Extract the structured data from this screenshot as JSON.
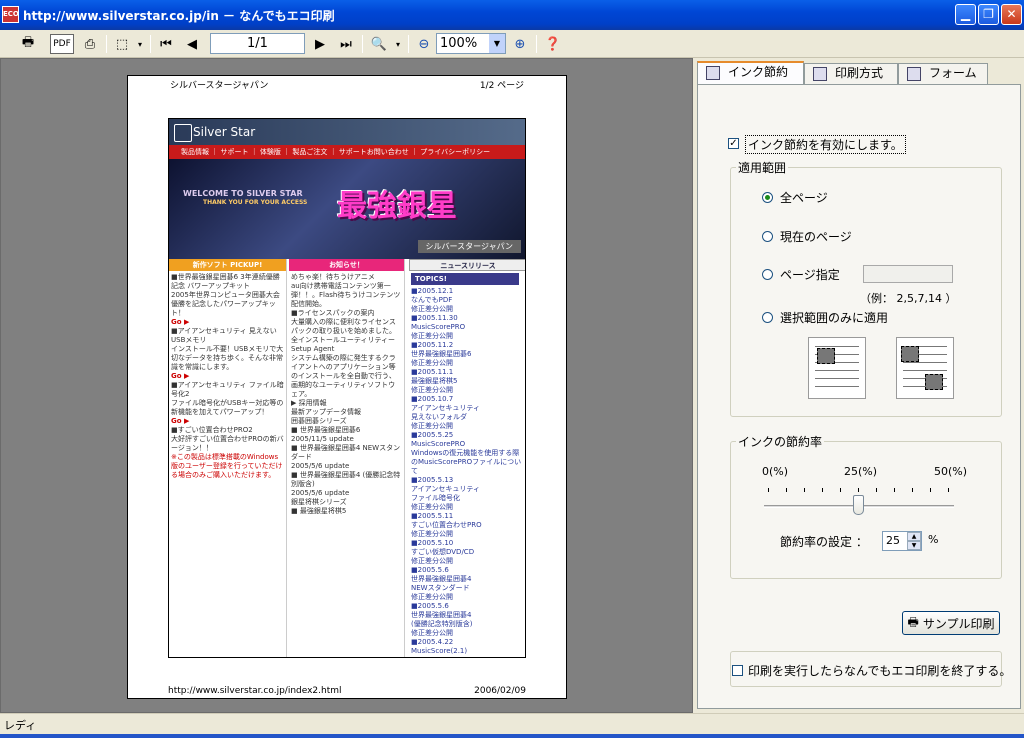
{
  "window": {
    "title": "http://www.silverstar.co.jp/in － なんでもエコ印刷",
    "app_icon": "eco-icon"
  },
  "toolbar": {
    "page_value": "1/1",
    "zoom_value": "100%",
    "buttons": [
      "print-icon",
      "pdf-icon",
      "printer-settings-icon",
      "select-icon",
      "first-page-icon",
      "prev-page-icon",
      "next-page-icon",
      "last-page-icon",
      "zoom-icon",
      "zoom-out-icon",
      "zoom-in-icon",
      "help-icon"
    ]
  },
  "preview": {
    "header_left": "シルバースタージャパン",
    "header_right": "1/2 ページ",
    "footer_left": "http://www.silverstar.co.jp/index2.html",
    "footer_right": "2006/02/09",
    "site": {
      "logo": "Silver Star",
      "nav": "製品情報 ｜ サポート ｜ 体験版 ｜ 製品ご注文 ｜ サポートお問い合わせ ｜ プライバシーポリシー",
      "welcome": "WELCOME TO SILVER STAR",
      "welcome_sub": "THANK YOU FOR YOUR ACCESS",
      "banner_title": "最強銀星",
      "banner_sub": "シルバースタージャパン",
      "col1_head": "新作ソフト PICKUP!",
      "col2_head": "お知らせ！",
      "col3_head": "ニュースリリース",
      "topics": "TOPICS!",
      "col1_items": [
        "■世界最強銀星囲碁6 3年連続優勝記念 バワーアップキット",
        "2005年世界コンピュータ囲碁大会優勝を記念したパワーアップキット！",
        "Go ▶",
        "■アイアンセキュリティ 見えないUSBメモリ",
        "インストール不要！USBメモリで大切なデータを持ち歩く。そんな非常識を常識にします。",
        "Go ▶",
        "■アイアンセキュリティ ファイル暗号化2",
        "ファイル暗号化がUSBキー対応等の新機能を加えてパワーアップ！",
        "Go ▶",
        "■すごい位置合わせPRO2",
        "大好評すごい位置合わせPROの新バージョン！！"
      ],
      "col1_note": "※この製品は標準搭載のWindows版のユーザー登録を行っていただける場合のみご購入いただけます。",
      "col2_items": [
        "めちゃ楽！待ちうけアニメ",
        "au向け携帯電話コンテンツ第一弾！！。Flash待ちうけコンテンツ配信開始。",
        "■ライセンスパックの案内",
        "大量購入の際に便利なライセンスパックの取り扱いを始めました。",
        "全インストールユーティリティー",
        "Setup Agent",
        "システム構築の際に発生するクライアントへのアプリケーション等のインストールを全自動で行う、画期的なユーティリティソフトウェア。",
        "▶ 採用情報",
        "最新アップデータ情報",
        "囲碁囲碁シリーズ",
        "■ 世界最強銀星囲碁6",
        "2005/11/5 update",
        "■ 世界最強銀星囲碁4 NEWスタンダード",
        "2005/5/6 update",
        "■ 世界最強銀星囲碁4 (優勝記念特別版含)",
        "2005/5/6 update",
        "銀星将棋シリーズ",
        "■ 最強銀星将棋5"
      ],
      "col3_items": [
        "■2005.12.1",
        "なんでもPDF",
        "修正差分公開",
        "■2005.11.30",
        "MusicScorePRO",
        "修正差分公開",
        "■2005.11.2",
        "世界最強銀星囲碁6",
        "修正差分公開",
        "■2005.11.1",
        "最強銀星将棋5",
        "修正差分公開",
        "■2005.10.7",
        "アイアンセキュリティ",
        "見えないフォルダ",
        "修正差分公開",
        "■2005.5.25",
        "MusicScorePRO",
        "Windowsの復元機能を使用する際のMusicScorePROファイルについて",
        "■2005.5.13",
        "アイアンセキュリティ",
        "ファイル暗号化",
        "修正差分公開",
        "■2005.5.11",
        "すごい位置合わせPRO",
        "修正差分公開",
        "■2005.5.10",
        "すごい仮想DVD/CD",
        "修正差分公開",
        "■2005.5.6",
        "世界最強銀星囲碁4",
        "NEWスタンダード",
        "修正差分公開",
        "■2005.5.6",
        "世界最強銀星囲碁4",
        "(優勝記念特別版含)",
        "修正差分公開",
        "■2005.4.22",
        "MusicScore(2.1)"
      ]
    }
  },
  "status": {
    "text": "レディ"
  },
  "panel": {
    "tabs": [
      {
        "label": "インク節約",
        "icon": "ink-icon"
      },
      {
        "label": "印刷方式",
        "icon": "print-method-icon"
      },
      {
        "label": "フォーム",
        "icon": "form-icon"
      }
    ],
    "enable_saving": {
      "label": "インク節約を有効にします。",
      "checked": true
    },
    "scope": {
      "group_label": "適用範囲",
      "options": [
        "全ページ",
        "現在のページ",
        "ページ指定",
        "選択範囲のみに適用"
      ],
      "selected": "全ページ",
      "page_spec_value": "",
      "example": "（例： 2,5,7,14 ）"
    },
    "rate": {
      "group_label": "インクの節約率",
      "tick_labels": [
        "0(%)",
        "25(%)",
        "50(%)"
      ],
      "setting_label": "節約率の設定 ：",
      "value": "25",
      "unit": "%",
      "fraction": 0.5
    },
    "sample_print_label": "サンプル印刷",
    "end_after_print": {
      "label": "印刷を実行したらなんでもエコ印刷を終了する。",
      "checked": false
    }
  }
}
